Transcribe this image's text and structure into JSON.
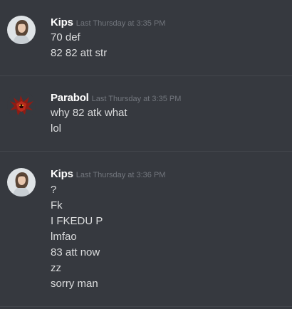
{
  "messages": [
    {
      "author": "Kips",
      "avatar": "female-portrait-avatar",
      "timestamp": "Last Thursday at 3:35 PM",
      "lines": [
        "70 def",
        "82 82 att str"
      ]
    },
    {
      "author": "Parabol",
      "avatar": "red-dragon-avatar",
      "timestamp": "Last Thursday at 3:35 PM",
      "lines": [
        "why 82 atk what",
        "lol"
      ]
    },
    {
      "author": "Kips",
      "avatar": "female-portrait-avatar",
      "timestamp": "Last Thursday at 3:36 PM",
      "lines": [
        "?",
        "Fk",
        "I FKEDU P",
        "lmfao",
        "83 att now",
        "zz",
        "sorry man"
      ]
    }
  ],
  "colors": {
    "background": "#36393f",
    "divider": "#42454b",
    "username": "#ffffff",
    "timestamp": "#72767d",
    "text": "#dcddde"
  }
}
